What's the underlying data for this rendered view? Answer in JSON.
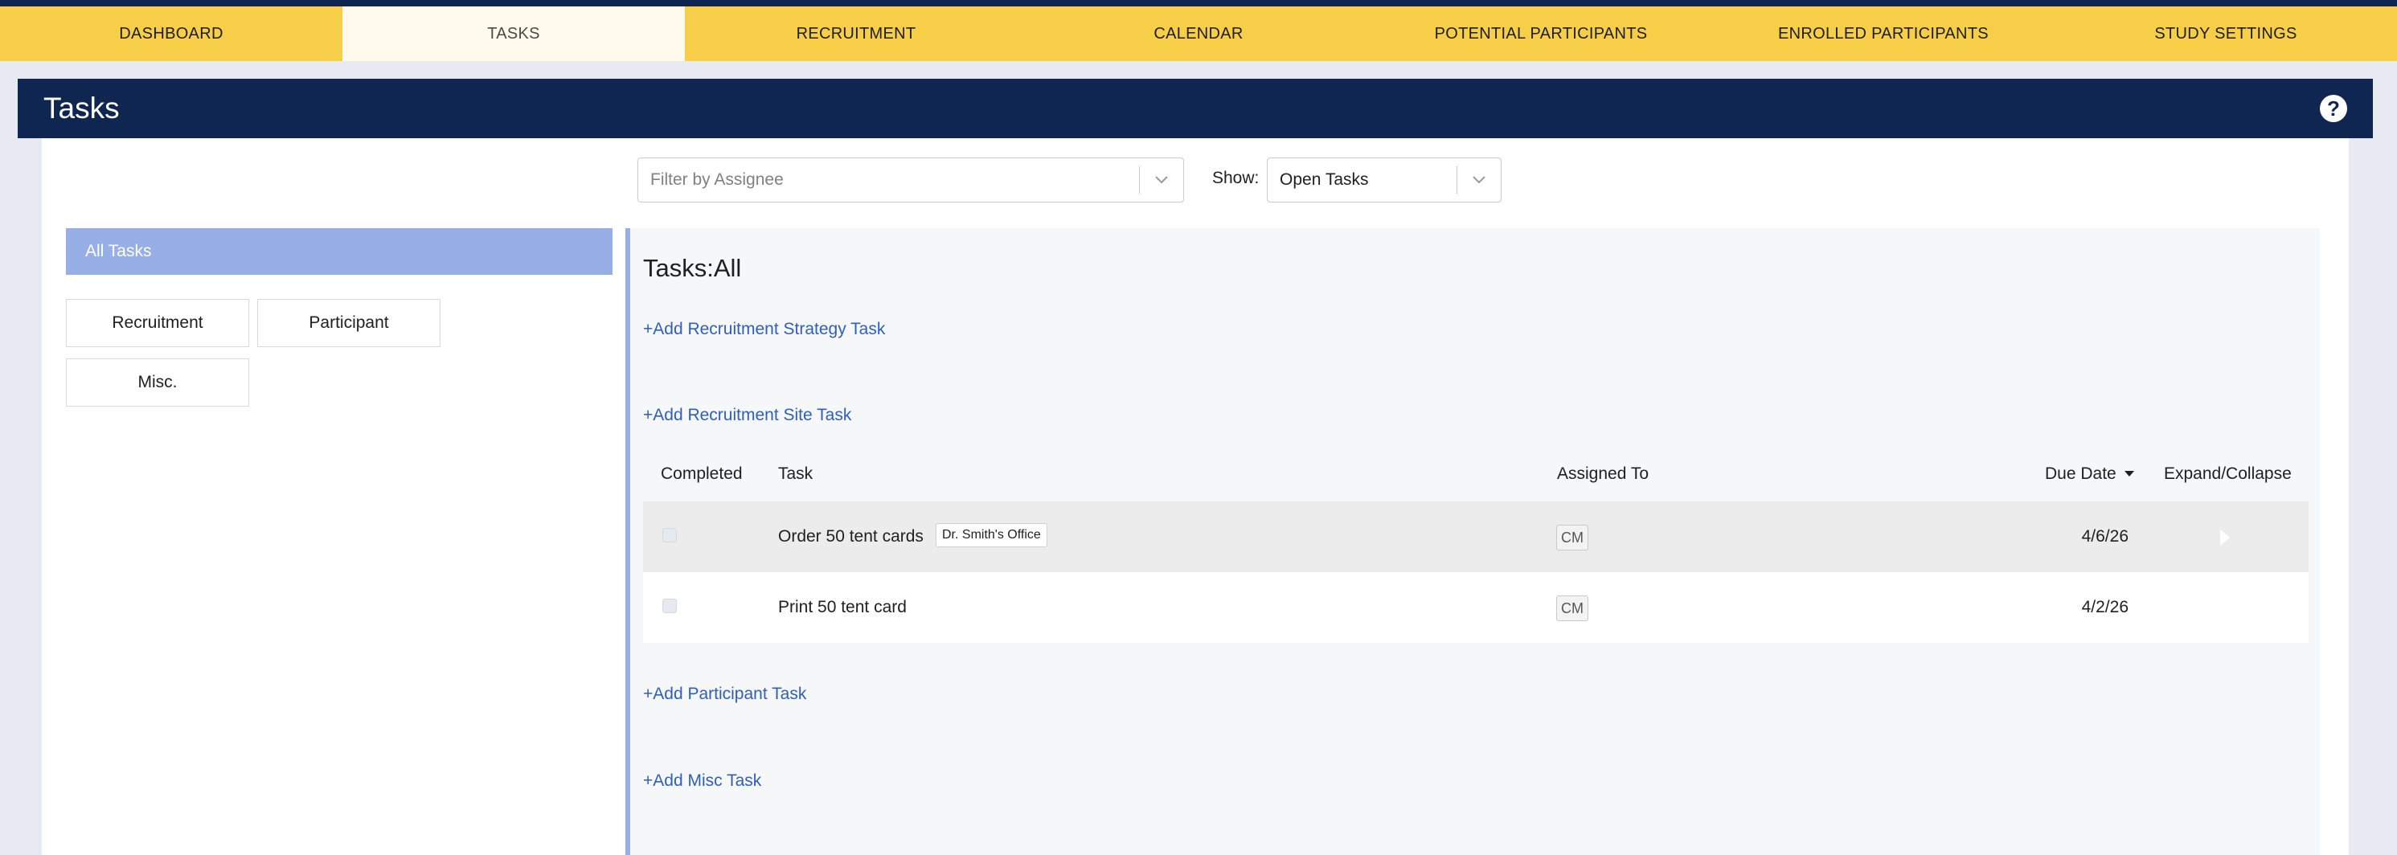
{
  "nav": {
    "tabs": [
      {
        "label": "DASHBOARD"
      },
      {
        "label": "TASKS"
      },
      {
        "label": "RECRUITMENT"
      },
      {
        "label": "CALENDAR"
      },
      {
        "label": "POTENTIAL PARTICIPANTS"
      },
      {
        "label": "ENROLLED PARTICIPANTS"
      },
      {
        "label": "STUDY SETTINGS"
      }
    ],
    "active": "TASKS"
  },
  "header": {
    "title": "Tasks",
    "help_icon": "question-circle"
  },
  "filters": {
    "assignee_placeholder": "Filter by Assignee",
    "show_label": "Show:",
    "show_value": "Open Tasks"
  },
  "sidebar": {
    "all_tasks": "All Tasks",
    "categories": [
      "Recruitment",
      "Participant",
      "Misc."
    ]
  },
  "main": {
    "heading": "Tasks:All",
    "add_links": {
      "strategy": "+Add Recruitment Strategy Task",
      "site": "+Add Recruitment Site Task",
      "participant": "+Add Participant Task",
      "misc": "+Add Misc Task"
    },
    "table": {
      "columns": {
        "completed": "Completed",
        "task": "Task",
        "assigned": "Assigned To",
        "due": "Due Date",
        "expand": "Expand/Collapse"
      },
      "rows": [
        {
          "task": "Order 50 tent cards",
          "tag": "Dr. Smith's Office",
          "assignee": "CM",
          "due": "4/6/26",
          "completed": false
        },
        {
          "task": "Print 50 tent card",
          "tag": "",
          "assignee": "CM",
          "due": "4/2/26",
          "completed": false
        }
      ]
    }
  },
  "colors": {
    "nav_bg": "#f7ce47",
    "nav_active_bg": "#fffaeb",
    "header_bg": "#0e2650",
    "accent": "#97aee6",
    "link": "#2e5fbf"
  }
}
